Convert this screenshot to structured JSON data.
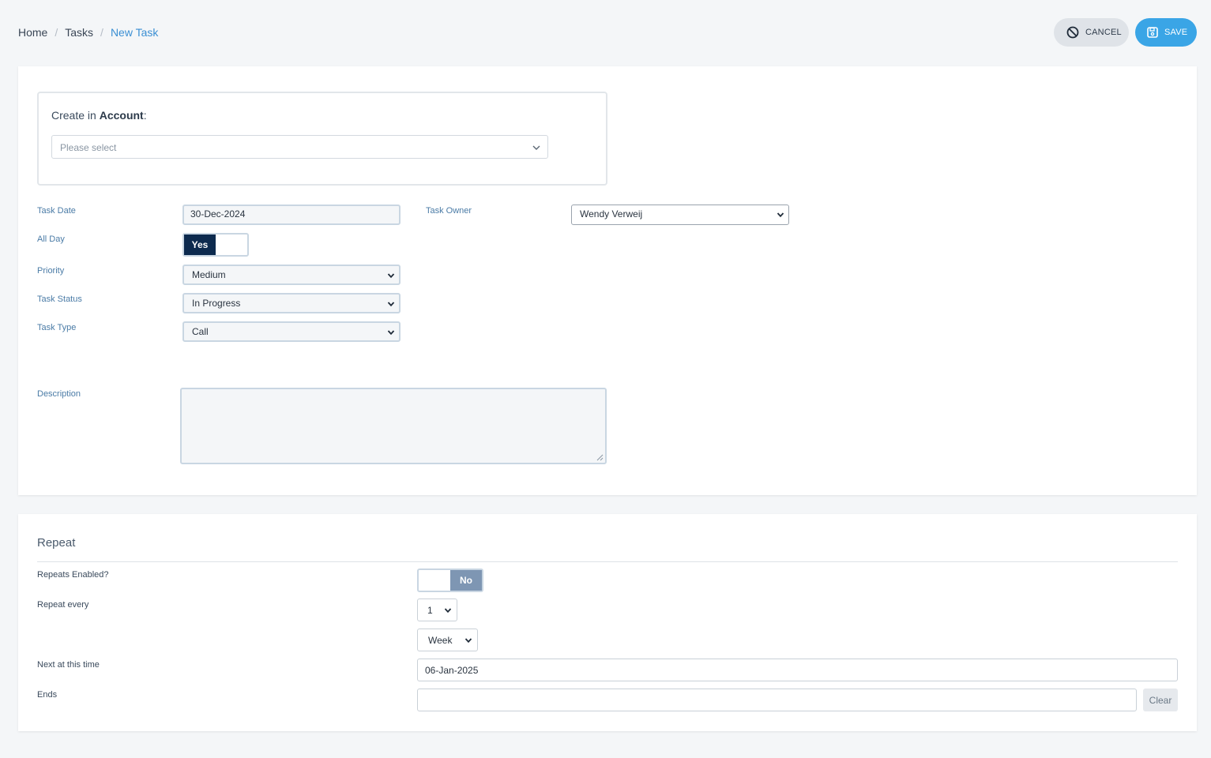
{
  "breadcrumb": {
    "home": "Home",
    "tasks": "Tasks",
    "current": "New Task",
    "separator": "/"
  },
  "actions": {
    "cancel": "CANCEL",
    "save": "SAVE"
  },
  "account": {
    "prefix": "Create in ",
    "entity": "Account",
    "suffix": ":",
    "placeholder": "Please select"
  },
  "form": {
    "task_date": {
      "label": "Task Date",
      "value": "30-Dec-2024"
    },
    "task_owner": {
      "label": "Task Owner",
      "value": "Wendy Verweij"
    },
    "all_day": {
      "label": "All Day",
      "value": "Yes"
    },
    "priority": {
      "label": "Priority",
      "value": "Medium"
    },
    "task_status": {
      "label": "Task Status",
      "value": "In Progress"
    },
    "task_type": {
      "label": "Task Type",
      "value": "Call"
    },
    "description": {
      "label": "Description",
      "value": ""
    }
  },
  "repeat": {
    "title": "Repeat",
    "enabled": {
      "label": "Repeats Enabled?",
      "value": "No"
    },
    "every": {
      "label": "Repeat every",
      "count": "1",
      "unit": "Week"
    },
    "next": {
      "label": "Next at this time",
      "value": "06-Jan-2025"
    },
    "ends": {
      "label": "Ends",
      "value": "",
      "clear": "Clear"
    }
  },
  "colors": {
    "accent": "#3aa5e6",
    "dark_toggle": "#0d2a4e",
    "off_toggle": "#7e96b3",
    "label": "#4a7ba6"
  }
}
